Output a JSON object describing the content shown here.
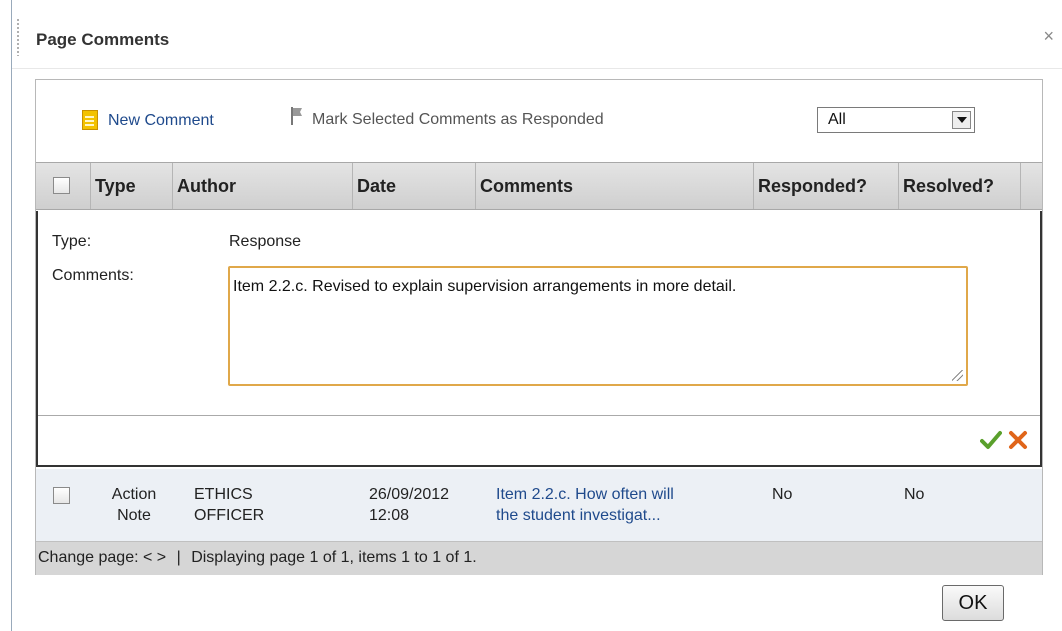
{
  "dialog": {
    "title": "Page Comments",
    "close": "×"
  },
  "toolbar": {
    "new_comment": "New Comment",
    "mark_responded": "Mark Selected Comments as Responded",
    "filter": {
      "selected": "All"
    }
  },
  "table": {
    "columns": [
      "Type",
      "Author",
      "Date",
      "Comments",
      "Responded?",
      "Resolved?"
    ]
  },
  "editor": {
    "type_label": "Type:",
    "type_value": "Response",
    "comments_label": "Comments:",
    "comments_value": "Item 2.2.c. Revised to explain supervision arrangements in more detail."
  },
  "rows": [
    {
      "type_line1": "Action",
      "type_line2": "Note",
      "author_line1": "ETHICS",
      "author_line2": "OFFICER",
      "date_line1": "26/09/2012",
      "date_line2": "12:08",
      "comment_line1": "Item 2.2.c. How often will",
      "comment_line2": "the student investigat...",
      "responded": "No",
      "resolved": "No"
    }
  ],
  "pager": {
    "label": "Change page:",
    "prev": "<",
    "next": ">",
    "sep": "|",
    "status": "Displaying page 1 of 1, items 1 to 1 of 1."
  },
  "ok_button": "OK",
  "colors": {
    "link": "#1f4a8c",
    "accent_border": "#e0a84a",
    "header_bg": "#d8d8d8",
    "row_bg": "#ecf0f5"
  }
}
